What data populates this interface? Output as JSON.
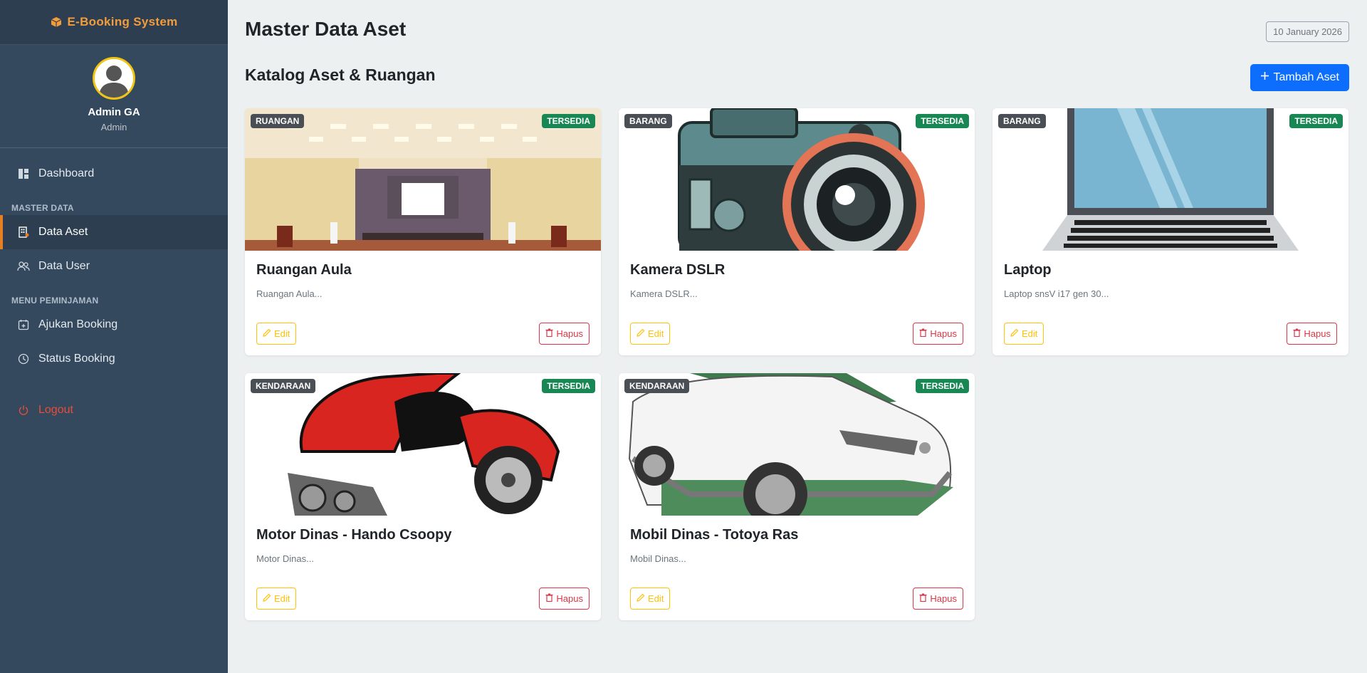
{
  "sidebar": {
    "brand": "E-Booking System",
    "user_name": "Admin GA",
    "user_role": "Admin",
    "items": [
      {
        "label": "Dashboard",
        "icon": "dashboard-icon"
      },
      {
        "section": "MASTER DATA"
      },
      {
        "label": "Data Aset",
        "icon": "building-icon",
        "active": true
      },
      {
        "label": "Data User",
        "icon": "users-icon"
      },
      {
        "section": "MENU PEMINJAMAN"
      },
      {
        "label": "Ajukan Booking",
        "icon": "calendar-plus-icon"
      },
      {
        "label": "Status Booking",
        "icon": "clock-icon"
      },
      {
        "label": "Logout",
        "icon": "power-icon"
      }
    ],
    "sections": {
      "master": "MASTER DATA",
      "peminjaman": "MENU PEMINJAMAN"
    },
    "labels": {
      "dashboard": "Dashboard",
      "data_aset": "Data Aset",
      "data_user": "Data User",
      "ajukan_booking": "Ajukan Booking",
      "status_booking": "Status Booking",
      "logout": "Logout"
    }
  },
  "header": {
    "title": "Master Data Aset",
    "date": "10 January 2026"
  },
  "catalog": {
    "title": "Katalog Aset & Ruangan",
    "add_label": "Tambah Aset",
    "edit_label": "Edit",
    "delete_label": "Hapus",
    "assets": [
      {
        "category": "RUANGAN",
        "status": "TERSEDIA",
        "name": "Ruangan Aula",
        "desc": "Ruangan Aula..."
      },
      {
        "category": "BARANG",
        "status": "TERSEDIA",
        "name": "Kamera DSLR",
        "desc": "Kamera DSLR..."
      },
      {
        "category": "BARANG",
        "status": "TERSEDIA",
        "name": "Laptop",
        "desc": "Laptop snsV i17 gen 30..."
      },
      {
        "category": "KENDARAAN",
        "status": "TERSEDIA",
        "name": "Motor Dinas - Hando Csoopy",
        "desc": "Motor Dinas..."
      },
      {
        "category": "KENDARAAN",
        "status": "TERSEDIA",
        "name": "Mobil Dinas - Totoya Ras",
        "desc": "Mobil Dinas..."
      }
    ]
  },
  "colors": {
    "sidebar_bg": "#34495e",
    "brand_accent": "#f39c3c",
    "primary": "#0d6efd",
    "success": "#198754",
    "warning": "#ffc107",
    "danger": "#dc3545"
  }
}
